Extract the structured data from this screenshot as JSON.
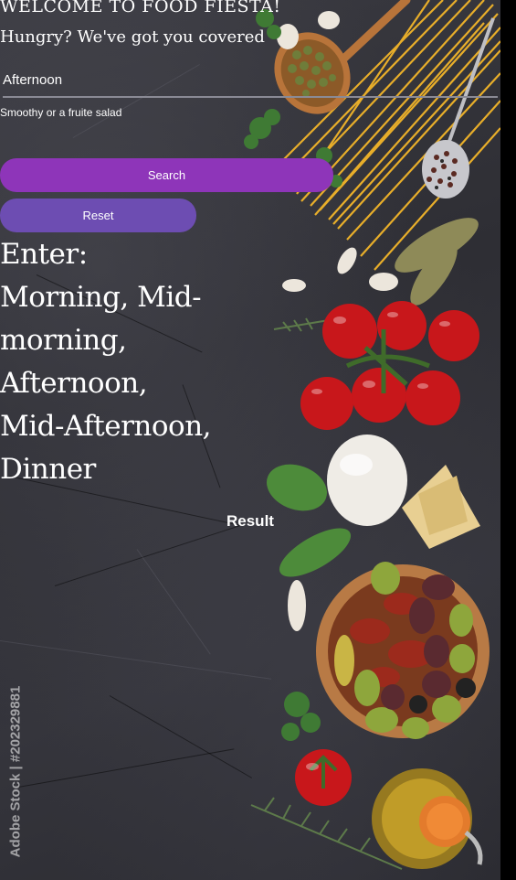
{
  "header": {
    "title": "WELCOME TO FOOD FIESTA!",
    "subtitle": "Hungry? We've got you covered"
  },
  "form": {
    "time_value": "Afternoon",
    "suggestion": "Smoothy or a fruite salad",
    "search_label": "Search",
    "reset_label": "Reset"
  },
  "instructions": "Enter: Morning, Mid-morning, Afternoon, Mid-Afternoon, Dinner",
  "result_label": "Result",
  "watermark": "Adobe Stock | #202329881",
  "colors": {
    "search_button": "#8e35b9",
    "reset_button": "#6d4db2",
    "background": "#333339"
  },
  "icons": [
    "wooden-spoon-capers",
    "spaghetti",
    "peppercorn-spoon",
    "cherry-tomatoes",
    "mozzarella",
    "parmesan",
    "basil",
    "olive-bowl",
    "olive-oil-bottle",
    "garlic",
    "bay-leaves",
    "rosemary",
    "parsley"
  ]
}
